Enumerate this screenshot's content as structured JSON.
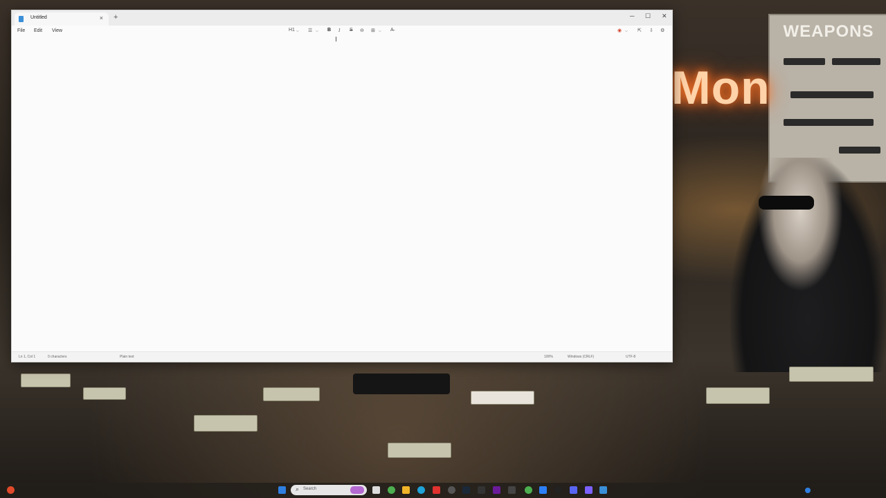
{
  "wallpaper": {
    "sign_text": "Mon",
    "poster_title": "WEAPONS"
  },
  "window": {
    "tab_title": "Untitled",
    "tab_close": "×",
    "new_tab": "+",
    "minimize": "─",
    "maximize": "☐",
    "close": "✕"
  },
  "menu": {
    "items": [
      "File",
      "Edit",
      "View"
    ]
  },
  "toolbar": {
    "heading": "H1",
    "heading_chevron": "⌵",
    "list": "☰",
    "list_chevron": "⌵",
    "bold": "B",
    "italic": "I",
    "strike": "S",
    "link": "⊖",
    "table": "⊞",
    "table_chevron": "⌵",
    "clear_format": "A̶",
    "copilot": "◉",
    "copilot_chevron": "⌵",
    "share": "⇱",
    "download": "⇩",
    "settings": "⚙"
  },
  "status": {
    "position": "Ln 1, Col 1",
    "chars": "0 characters",
    "format": "Plain text",
    "zoom": "100%",
    "line_ending": "Windows (CRLF)",
    "encoding": "UTF-8"
  },
  "taskbar": {
    "search_placeholder": "Search",
    "search_icon": "⌕"
  },
  "colors": {
    "accent": "#3a8fd8"
  }
}
